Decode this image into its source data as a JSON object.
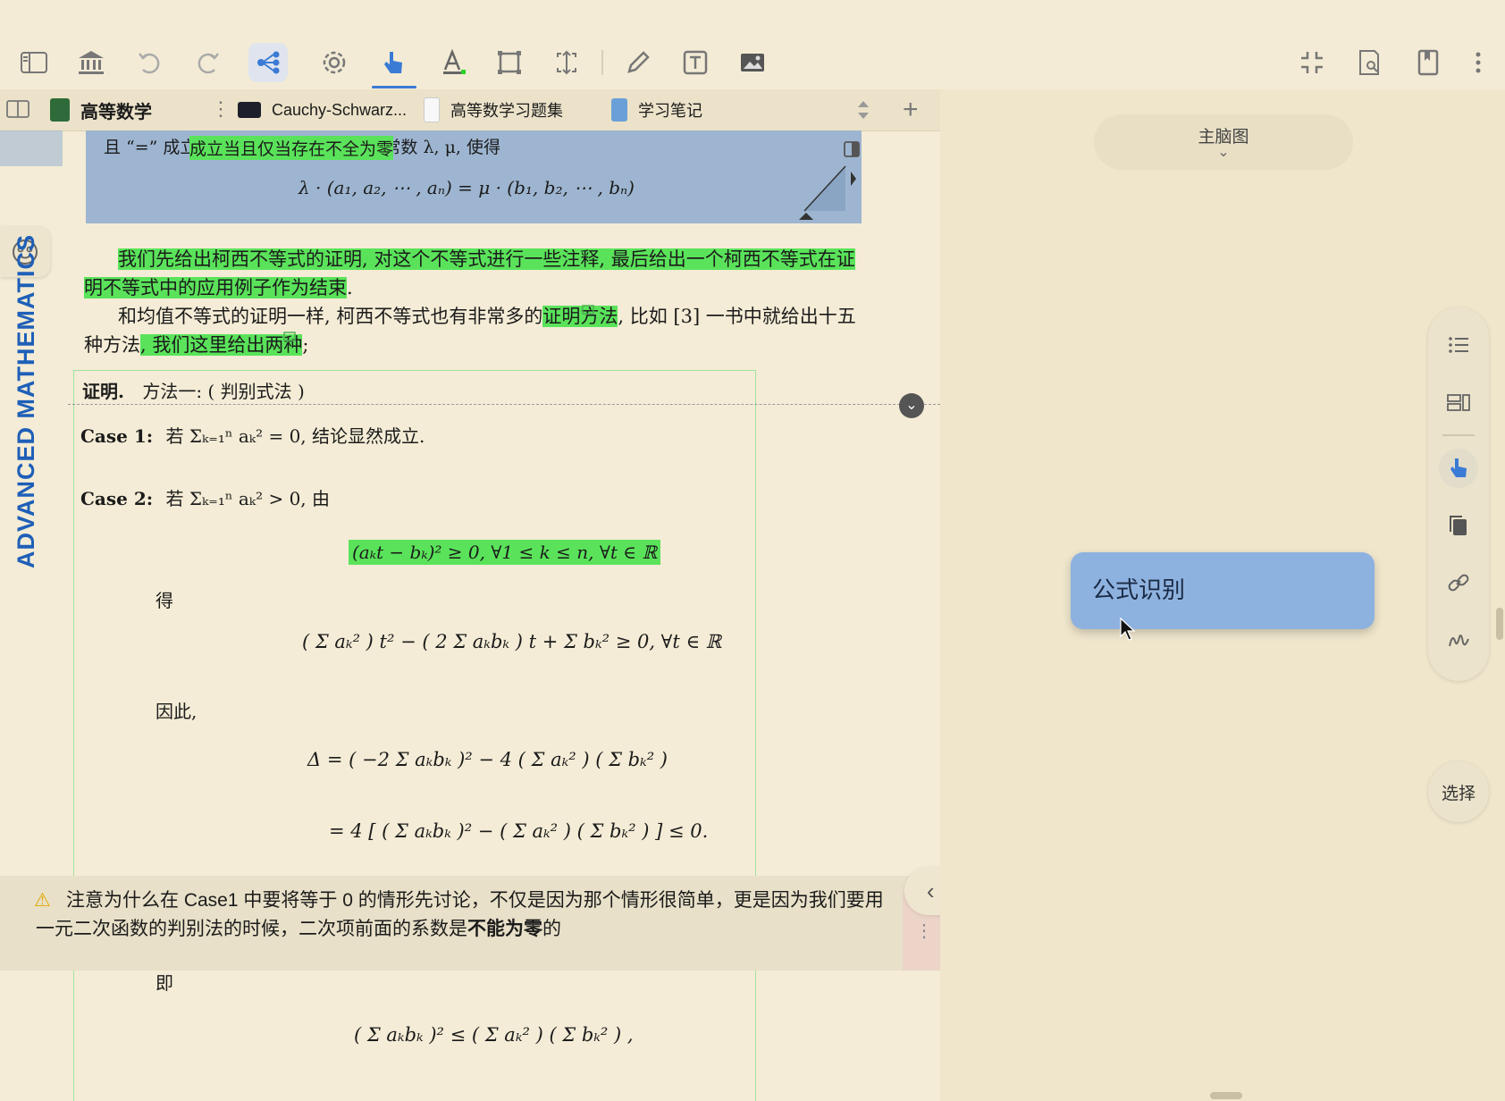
{
  "tabs": [
    {
      "label": "高等数学",
      "color": "#2f6b3a",
      "active": true
    },
    {
      "label": "Cauchy-Schwarz...",
      "color": "#1d1f2a",
      "active": false
    },
    {
      "label": "高等数学习题集",
      "color": "#f2f2f2",
      "active": false
    },
    {
      "label": "学习笔记",
      "color": "#6aa0d8",
      "active": false
    }
  ],
  "left_rail": {
    "vertical_title": "ADVANCED MATHEMATICS"
  },
  "doc": {
    "theorem_line": "且 “=” 成立当且仅当存在不全为零的常数 λ, μ, 使得",
    "theorem_highlight": "成立当且仅当存在不全为零",
    "theorem_formula": "λ · (a₁, a₂, ⋯ , aₙ) = μ · (b₁, b₂, ⋯ , bₙ)",
    "para1_a": "我们先给出柯西不等式的证明, 对这个不等式进行一些注释, 最后给出一个柯西不等式在证",
    "para1_b": "明不等式中的应用例子作为结束",
    "para2_a": "和均值不等式的证明一样, 柯西不等式也有非常多的",
    "para2_hl": "证明方法",
    "para2_c": ", 比如 [3] 一书中就给出十五",
    "para2_d": "种方法",
    "para2_hl2": ", 我们这里给出两种",
    "proof_label": "证明.",
    "proof_method": "方法一: ( 判别式法 )",
    "case1_label": "Case 1:",
    "case1_text": "若 Σₖ₌₁ⁿ aₖ² = 0, 结论显然成立.",
    "case2_label": "Case 2:",
    "case2_text": "若 Σₖ₌₁ⁿ aₖ² > 0, 由",
    "eq1": "(aₖt − bₖ)² ≥ 0,    ∀1 ≤ k ≤ n,    ∀t ∈ ℝ",
    "de": "得",
    "eq2": "( Σ aₖ² ) t² − ( 2 Σ aₖbₖ ) t + Σ bₖ² ≥ 0,    ∀t ∈ ℝ",
    "yinci": "因此,",
    "eq3": "Δ = ( −2 Σ aₖbₖ )² − 4 ( Σ aₖ² ) ( Σ bₖ² )",
    "eq4": "= 4 [ ( Σ aₖbₖ )² − ( Σ aₖ² ) ( Σ bₖ² ) ] ≤ 0.",
    "ji": "即",
    "eq5": "( Σ aₖbₖ )² ≤ ( Σ aₖ² ) ( Σ bₖ² ) ,"
  },
  "warning": {
    "text_a": "注意为什么在 Case1 中要将等于 0 的情形先讨论，不仅是因为那个情形很简单，更是因为我们要用",
    "text_b": "一元二次函数的判别法的时候，二次项前面的系数是",
    "text_bold": "不能为零",
    "text_c": "的"
  },
  "right_panel": {
    "mindmap_label": "主脑图",
    "node_label": "公式识别",
    "select_label": "选择"
  },
  "colors": {
    "highlight": "#5ae35a",
    "accent": "#3a7bd5",
    "theorem_box": "#9db5d0",
    "node": "#8eb2df"
  }
}
